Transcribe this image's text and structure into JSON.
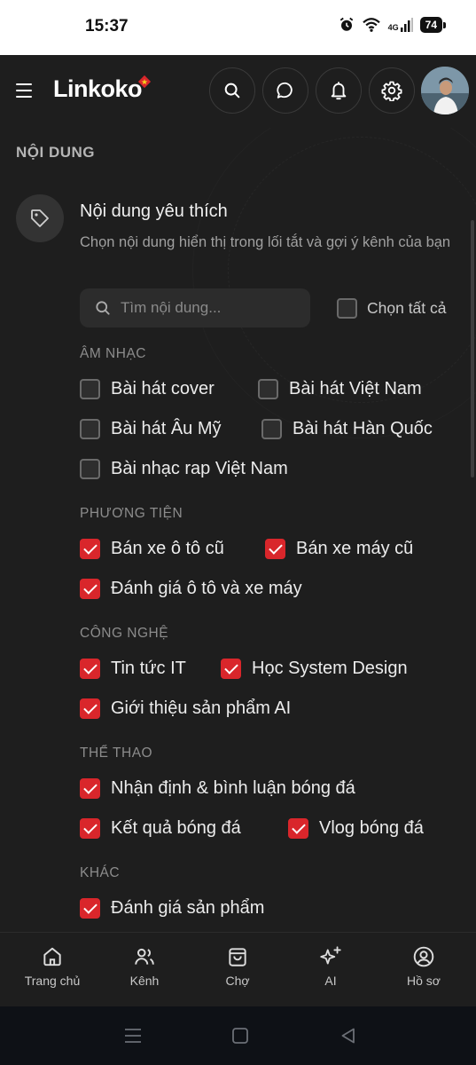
{
  "status_bar": {
    "time": "15:37",
    "network": "4G",
    "battery": "74",
    "icons": [
      "alarm-icon",
      "wifi-icon",
      "signal-icon",
      "battery-icon"
    ]
  },
  "header": {
    "logo_text": "Linkoko",
    "buttons": [
      "search-icon",
      "chat-icon",
      "bell-icon",
      "gear-icon"
    ]
  },
  "content": {
    "section_title": "NỘI DUNG",
    "pref_title": "Nội dung yêu thích",
    "pref_desc": "Chọn nội dung hiển thị trong lối tắt và gợi ý kênh của bạn",
    "search_placeholder": "Tìm nội dung...",
    "select_all_label": "Chọn tất cả",
    "groups": [
      {
        "label": "ÂM NHẠC",
        "items": [
          {
            "label": "Bài hát cover",
            "checked": false
          },
          {
            "label": "Bài hát Việt Nam",
            "checked": false
          },
          {
            "label": "Bài hát Âu Mỹ",
            "checked": false
          },
          {
            "label": "Bài hát Hàn Quốc",
            "checked": false
          },
          {
            "label": "Bài nhạc rap Việt Nam",
            "checked": false
          }
        ]
      },
      {
        "label": "PHƯƠNG TIỆN",
        "items": [
          {
            "label": "Bán xe ô tô cũ",
            "checked": true
          },
          {
            "label": "Bán xe máy cũ",
            "checked": true
          },
          {
            "label": "Đánh giá ô tô và xe máy",
            "checked": true
          }
        ]
      },
      {
        "label": "CÔNG NGHỆ",
        "items": [
          {
            "label": "Tin tức IT",
            "checked": true
          },
          {
            "label": "Học System Design",
            "checked": true
          },
          {
            "label": "Giới thiệu sản phẩm AI",
            "checked": true
          }
        ]
      },
      {
        "label": "THỂ THAO",
        "items": [
          {
            "label": "Nhận định & bình luận bóng đá",
            "checked": true
          },
          {
            "label": "Kết quả bóng đá",
            "checked": true
          },
          {
            "label": "Vlog bóng đá",
            "checked": true
          }
        ]
      },
      {
        "label": "KHÁC",
        "items": [
          {
            "label": "Đánh giá sản phẩm",
            "checked": true
          }
        ]
      }
    ]
  },
  "bottom_nav": [
    {
      "label": "Trang chủ",
      "icon": "home-icon"
    },
    {
      "label": "Kênh",
      "icon": "users-icon"
    },
    {
      "label": "Chợ",
      "icon": "shopping-bag-icon"
    },
    {
      "label": "AI",
      "icon": "sparkles-icon"
    },
    {
      "label": "Hồ sơ",
      "icon": "profile-icon"
    }
  ],
  "colors": {
    "background": "#1e1e1e",
    "accent": "#d9262b",
    "text": "#ececec",
    "muted": "#8c8c8c"
  }
}
